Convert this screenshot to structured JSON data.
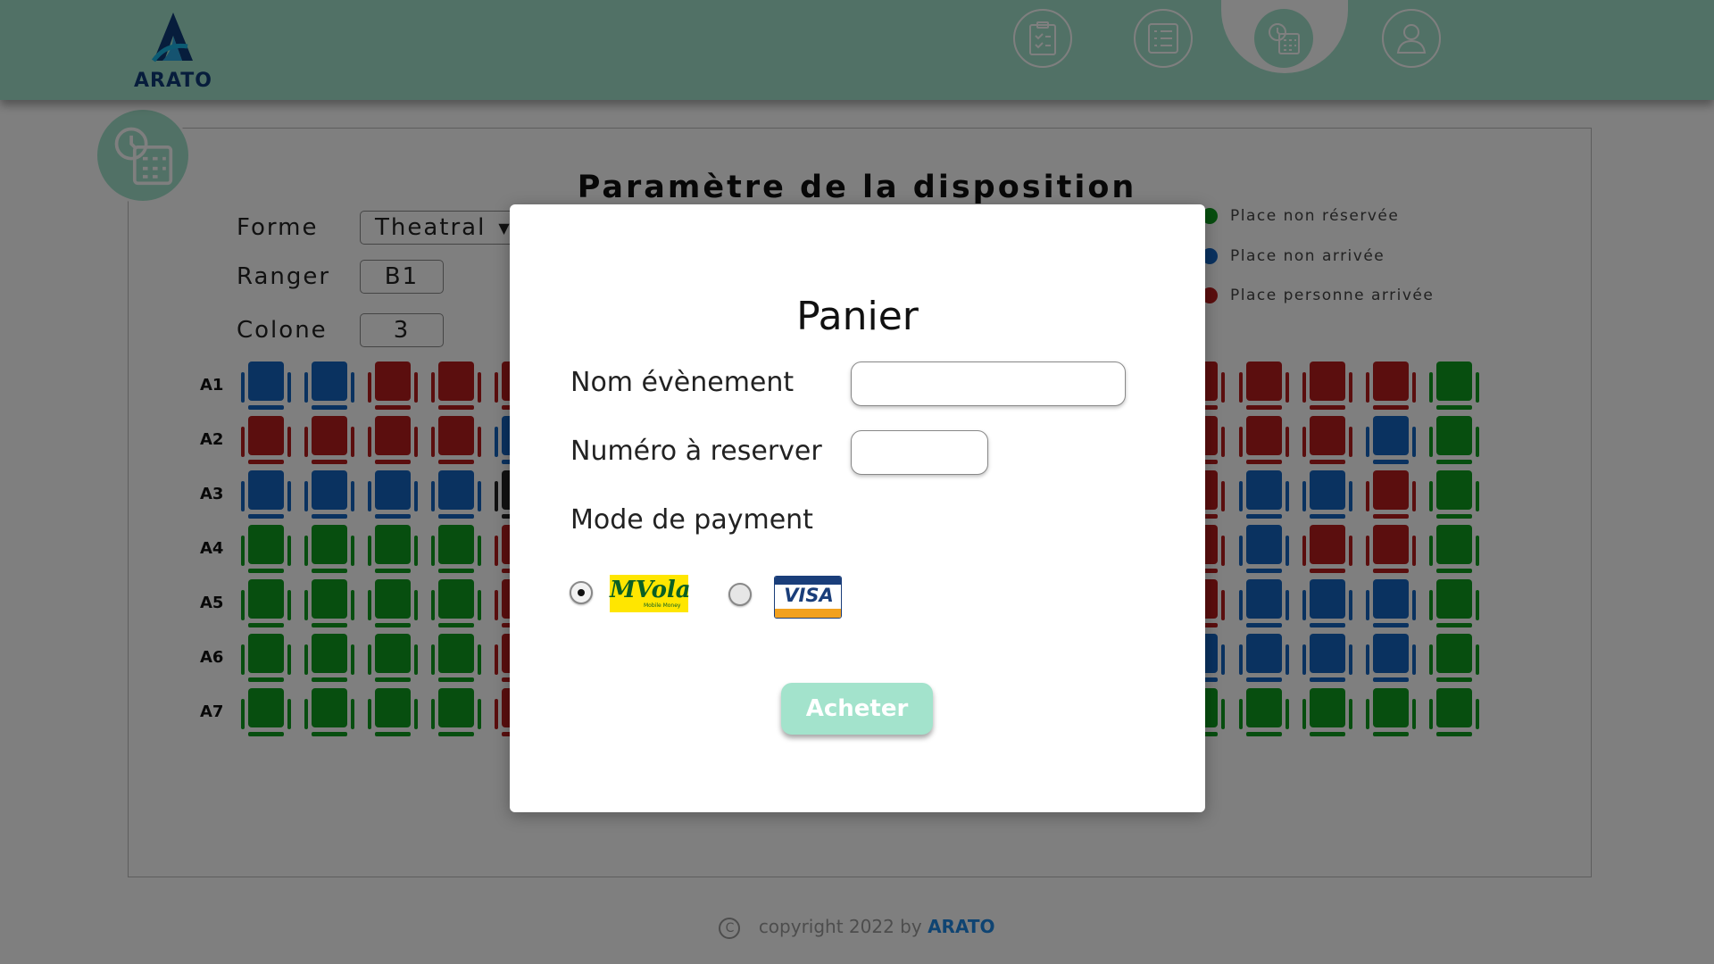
{
  "app": {
    "brand": "ARATO"
  },
  "colors": {
    "accent": "#a3e3cc",
    "seat_blue": "#1565c0",
    "seat_red": "#b71c1c",
    "seat_green": "#0f9d1e",
    "seat_black": "#222222"
  },
  "nav": {
    "items": [
      {
        "id": "tasks",
        "icon": "clipboard-check-icon"
      },
      {
        "id": "list",
        "icon": "list-icon"
      },
      {
        "id": "layout",
        "icon": "calendar-clock-icon",
        "active": true
      },
      {
        "id": "profile",
        "icon": "user-icon"
      }
    ]
  },
  "page": {
    "title": "Paramètre de la disposition",
    "forme_label": "Forme",
    "forme_value": "Theatral",
    "ranger_label": "Ranger",
    "ranger_value": "B1",
    "colone_label": "Colone",
    "colone_value": "3"
  },
  "legend": [
    {
      "label": "Place non réservée",
      "color": "#0f9d1e"
    },
    {
      "label": "Place non arrivée",
      "color": "#1565c0"
    },
    {
      "label": "Place personne arrivée",
      "color": "#b71c1c"
    }
  ],
  "seating": {
    "rows": [
      {
        "label": "A1",
        "left": [
          "B",
          "B",
          "R",
          "R",
          "R"
        ],
        "right": [
          "R",
          "R",
          "R",
          "R",
          "G"
        ]
      },
      {
        "label": "A2",
        "left": [
          "R",
          "R",
          "R",
          "R",
          "B"
        ],
        "right": [
          "R",
          "R",
          "R",
          "B",
          "G"
        ]
      },
      {
        "label": "A3",
        "left": [
          "B",
          "B",
          "B",
          "B",
          "K"
        ],
        "right": [
          "R",
          "B",
          "B",
          "R",
          "G"
        ]
      },
      {
        "label": "A4",
        "left": [
          "G",
          "G",
          "G",
          "G",
          "R"
        ],
        "right": [
          "R",
          "B",
          "R",
          "R",
          "G"
        ]
      },
      {
        "label": "A5",
        "left": [
          "G",
          "G",
          "G",
          "G",
          "R"
        ],
        "right": [
          "R",
          "B",
          "B",
          "B",
          "G"
        ]
      },
      {
        "label": "A6",
        "left": [
          "G",
          "G",
          "G",
          "G",
          "R"
        ],
        "right": [
          "B",
          "B",
          "B",
          "B",
          "G"
        ]
      },
      {
        "label": "A7",
        "left": [
          "G",
          "G",
          "G",
          "G",
          "R"
        ],
        "right": [
          "G",
          "G",
          "G",
          "G",
          "G"
        ]
      }
    ]
  },
  "modal": {
    "title": "Panier",
    "event_label": "Nom évènement",
    "event_value": "",
    "number_label": "Numéro à reserver",
    "number_value": "",
    "payment_label": "Mode de payment",
    "payment_options": [
      {
        "name": "MVola",
        "selected": true
      },
      {
        "name": "VISA",
        "selected": false
      }
    ],
    "mvola_tagline": "Mobile Money",
    "buy_label": "Acheter"
  },
  "footer": {
    "text": "copyright 2022 by",
    "brand": "ARATO",
    "icon": "copyright-icon"
  }
}
